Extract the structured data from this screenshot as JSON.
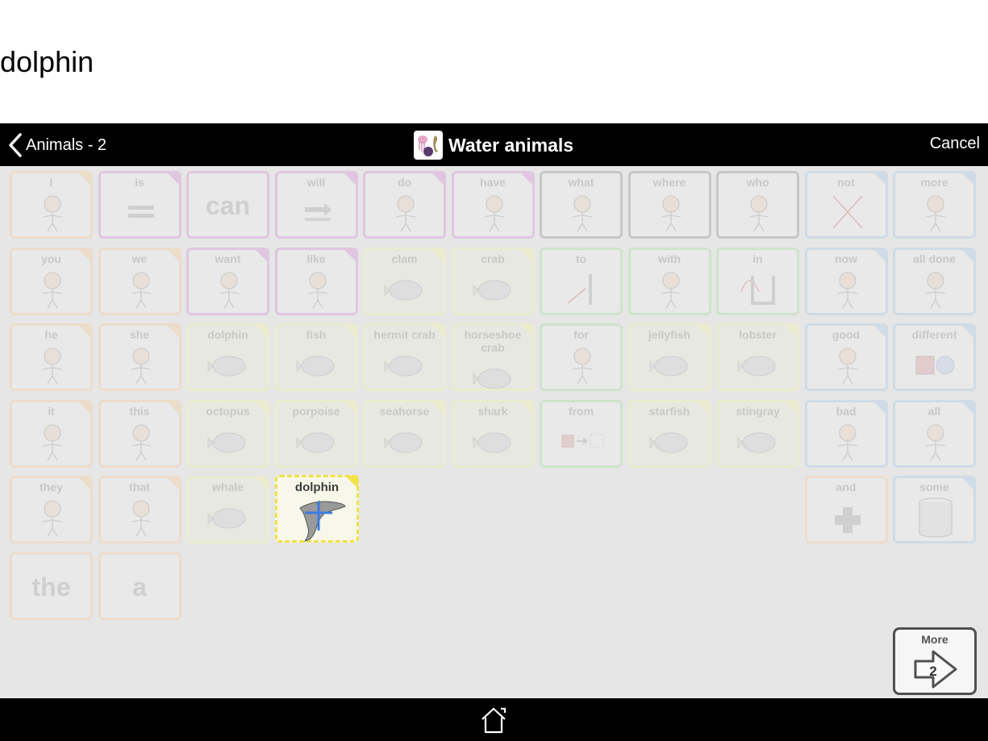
{
  "message_bar": {
    "text": "dolphin"
  },
  "navbar": {
    "back_label": "Animals - 2",
    "title": "Water animals",
    "title_icon": "water-animals-folder-icon",
    "cancel_label": "Cancel"
  },
  "tiles": [
    {
      "label": "I",
      "color": "orange",
      "icon": "person-pointing-self-icon",
      "row": 0,
      "col": 0
    },
    {
      "label": "is",
      "color": "purple",
      "icon": "equals-icon",
      "row": 0,
      "col": 1
    },
    {
      "label": "can",
      "color": "purple",
      "icon": "text-only",
      "row": 0,
      "col": 2,
      "big": true
    },
    {
      "label": "will",
      "color": "purple",
      "icon": "arrow-right-icon",
      "row": 0,
      "col": 3
    },
    {
      "label": "do",
      "color": "purple",
      "icon": "person-doing-icon",
      "row": 0,
      "col": 4
    },
    {
      "label": "have",
      "color": "purple",
      "icon": "person-holding-icon",
      "row": 0,
      "col": 5
    },
    {
      "label": "what",
      "color": "gray",
      "icon": "person-question-icon",
      "row": 0,
      "col": 6
    },
    {
      "label": "where",
      "color": "gray",
      "icon": "person-looking-question-icon",
      "row": 0,
      "col": 7
    },
    {
      "label": "who",
      "color": "gray",
      "icon": "person-question-face-icon",
      "row": 0,
      "col": 8
    },
    {
      "label": "not",
      "color": "blue",
      "icon": "cross-icon",
      "row": 0,
      "col": 9
    },
    {
      "label": "more",
      "color": "blue",
      "icon": "more-squares-icon",
      "row": 0,
      "col": 10
    },
    {
      "label": "you",
      "color": "orange",
      "icon": "two-people-pointing-icon",
      "row": 1,
      "col": 0
    },
    {
      "label": "we",
      "color": "orange",
      "icon": "two-faces-icon",
      "row": 1,
      "col": 1
    },
    {
      "label": "want",
      "color": "purple",
      "icon": "person-reaching-icon",
      "row": 1,
      "col": 2
    },
    {
      "label": "like",
      "color": "purple",
      "icon": "person-hugging-icon",
      "row": 1,
      "col": 3
    },
    {
      "label": "clam",
      "color": "yellow",
      "icon": "clam-icon",
      "row": 1,
      "col": 4
    },
    {
      "label": "crab",
      "color": "yellow",
      "icon": "crab-icon",
      "row": 1,
      "col": 5
    },
    {
      "label": "to",
      "color": "green",
      "icon": "arrow-to-line-icon",
      "row": 1,
      "col": 6
    },
    {
      "label": "with",
      "color": "green",
      "icon": "square-joining-group-icon",
      "row": 1,
      "col": 7
    },
    {
      "label": "in",
      "color": "green",
      "icon": "arrow-into-box-icon",
      "row": 1,
      "col": 8
    },
    {
      "label": "now",
      "color": "blue",
      "icon": "person-clock-icon",
      "row": 1,
      "col": 9
    },
    {
      "label": "all done",
      "color": "blue",
      "icon": "person-finished-icon",
      "row": 1,
      "col": 10
    },
    {
      "label": "he",
      "color": "orange",
      "icon": "boy-face-icon",
      "row": 2,
      "col": 0
    },
    {
      "label": "she",
      "color": "orange",
      "icon": "girl-face-icon",
      "row": 2,
      "col": 1
    },
    {
      "label": "dolphin",
      "color": "yellow",
      "icon": "dolphin-jumping-icon",
      "row": 2,
      "col": 2
    },
    {
      "label": "fish",
      "color": "yellow",
      "icon": "fish-icon",
      "row": 2,
      "col": 3
    },
    {
      "label": "hermit crab",
      "color": "yellow",
      "icon": "hermit-crab-icon",
      "row": 2,
      "col": 4
    },
    {
      "label": "horseshoe crab",
      "color": "yellow",
      "icon": "horseshoe-crab-icon",
      "row": 2,
      "col": 5
    },
    {
      "label": "for",
      "color": "green",
      "icon": "for-tag-icon",
      "row": 2,
      "col": 6
    },
    {
      "label": "jellyfish",
      "color": "yellow",
      "icon": "jellyfish-icon",
      "row": 2,
      "col": 7
    },
    {
      "label": "lobster",
      "color": "yellow",
      "icon": "lobster-icon",
      "row": 2,
      "col": 8
    },
    {
      "label": "good",
      "color": "blue",
      "icon": "person-thumbs-up-icon",
      "row": 2,
      "col": 9
    },
    {
      "label": "different",
      "color": "blue",
      "icon": "square-circle-icon",
      "row": 2,
      "col": 10
    },
    {
      "label": "it",
      "color": "orange",
      "icon": "hand-pointing-square-icon",
      "row": 3,
      "col": 0
    },
    {
      "label": "this",
      "color": "orange",
      "icon": "person-pointing-square-icon",
      "row": 3,
      "col": 1
    },
    {
      "label": "octopus",
      "color": "yellow",
      "icon": "octopus-icon",
      "row": 3,
      "col": 2
    },
    {
      "label": "porpoise",
      "color": "yellow",
      "icon": "porpoise-icon",
      "row": 3,
      "col": 3
    },
    {
      "label": "seahorse",
      "color": "yellow",
      "icon": "seahorse-icon",
      "row": 3,
      "col": 4
    },
    {
      "label": "shark",
      "color": "yellow",
      "icon": "shark-icon",
      "row": 3,
      "col": 5
    },
    {
      "label": "from",
      "color": "green",
      "icon": "square-arrow-from-icon",
      "row": 3,
      "col": 6
    },
    {
      "label": "starfish",
      "color": "yellow",
      "icon": "starfish-icon",
      "row": 3,
      "col": 7
    },
    {
      "label": "stingray",
      "color": "yellow",
      "icon": "stingray-icon",
      "row": 3,
      "col": 8
    },
    {
      "label": "bad",
      "color": "blue",
      "icon": "person-thumbs-down-icon",
      "row": 3,
      "col": 9
    },
    {
      "label": "all",
      "color": "blue",
      "icon": "all-squares-circle-icon",
      "row": 3,
      "col": 10
    },
    {
      "label": "they",
      "color": "orange",
      "icon": "group-people-icon",
      "row": 4,
      "col": 0
    },
    {
      "label": "that",
      "color": "orange",
      "icon": "hand-pointing-far-square-icon",
      "row": 4,
      "col": 1
    },
    {
      "label": "whale",
      "color": "yellow",
      "icon": "whale-icon",
      "row": 4,
      "col": 2
    },
    {
      "label": "and",
      "color": "orange",
      "icon": "plus-icon",
      "row": 4,
      "col": 9
    },
    {
      "label": "some",
      "color": "blue",
      "icon": "cylinder-icon",
      "row": 4,
      "col": 10
    },
    {
      "label": "the",
      "color": "orange",
      "icon": "text-only",
      "row": 5,
      "col": 0,
      "big": true
    },
    {
      "label": "a",
      "color": "orange",
      "icon": "text-only",
      "row": 5,
      "col": 1,
      "big": true
    }
  ],
  "active_tile": {
    "label": "dolphin",
    "icon": "dolphin-icon",
    "state": "selected-for-editing"
  },
  "more_button": {
    "label": "More",
    "page": "2"
  },
  "bottom_bar": {
    "home_icon": "home-icon"
  },
  "colors": {
    "orange": "#ecdcca",
    "purple": "#e0c6e0",
    "yellow": "#ebebd0",
    "green": "#cfe3cc",
    "gray": "#c7c7c7",
    "blue": "#cfdbe6",
    "active_border": "#f0e24a",
    "navbar": "#000000"
  }
}
